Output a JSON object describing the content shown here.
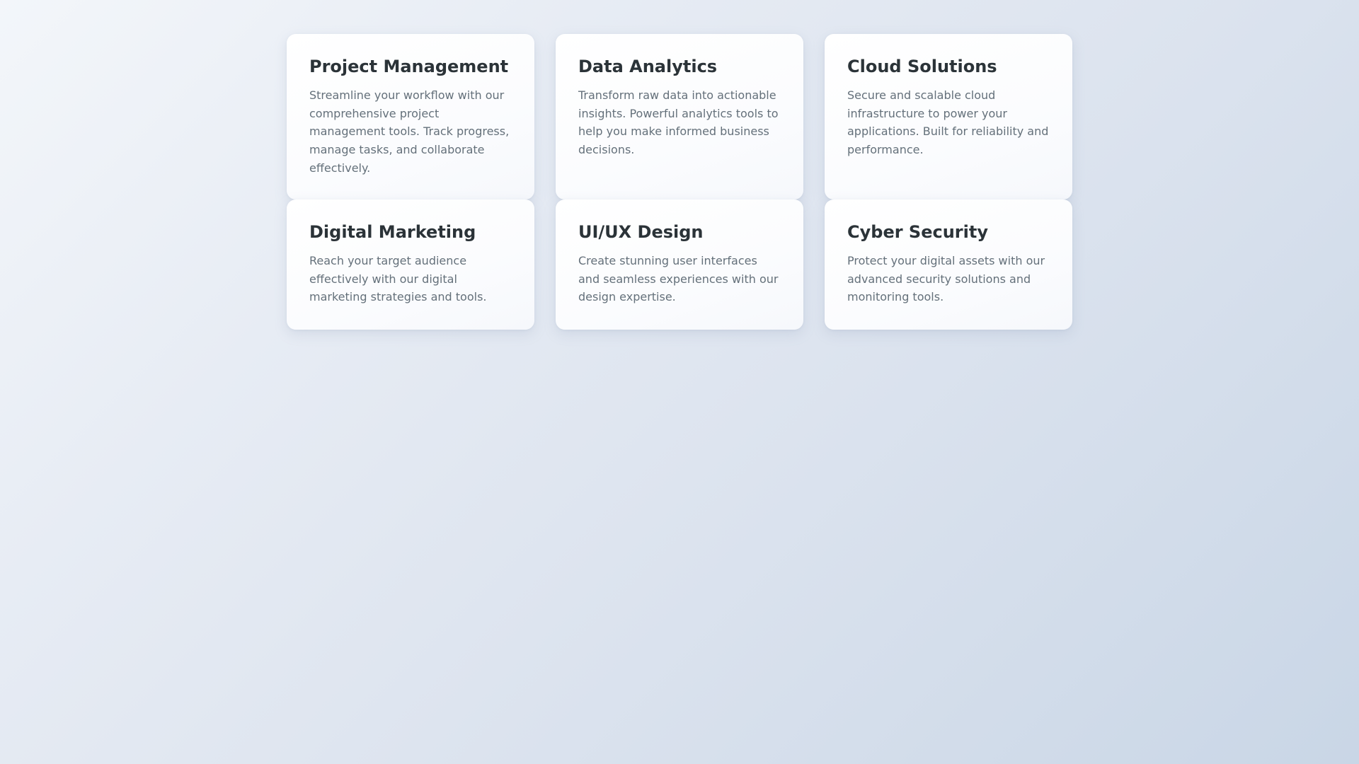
{
  "cards": [
    {
      "title": "Project Management",
      "description": "Streamline your workflow with our comprehensive project management tools. Track progress, manage tasks, and collaborate effectively."
    },
    {
      "title": "Data Analytics",
      "description": "Transform raw data into actionable insights. Powerful analytics tools to help you make informed business decisions."
    },
    {
      "title": "Cloud Solutions",
      "description": "Secure and scalable cloud infrastructure to power your applications. Built for reliability and performance."
    },
    {
      "title": "Digital Marketing",
      "description": "Reach your target audience effectively with our digital marketing strategies and tools."
    },
    {
      "title": "UI/UX Design",
      "description": "Create stunning user interfaces and seamless experiences with our design expertise."
    },
    {
      "title": "Cyber Security",
      "description": "Protect your digital assets with our advanced security solutions and monitoring tools."
    }
  ],
  "colors": {
    "title": "#2b3338",
    "description": "#64707a",
    "card_background": "#ffffff",
    "page_gradient_start": "#f3f6fa",
    "page_gradient_end": "#c9d6e6"
  }
}
